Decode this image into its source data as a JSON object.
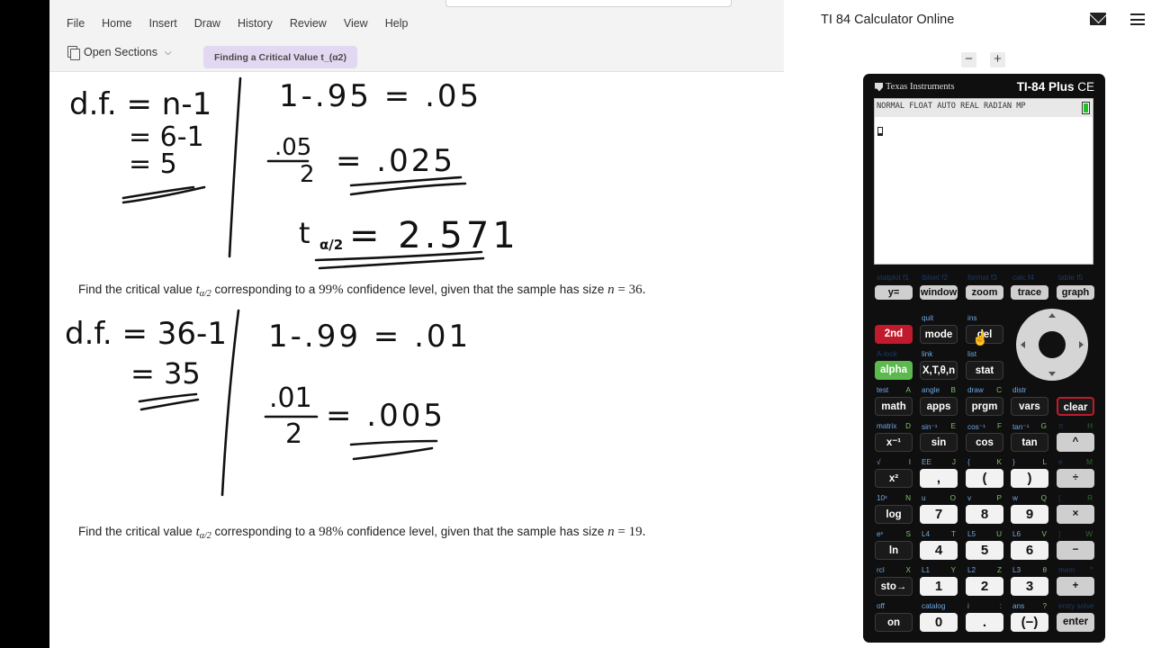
{
  "onenote": {
    "menu": [
      "File",
      "Home",
      "Insert",
      "Draw",
      "History",
      "Review",
      "View",
      "Help"
    ],
    "open_sections_label": "Open Sections",
    "page_tab_label": "Finding a Critical Value t_(α2)",
    "problem2": {
      "prefix": "Find the critical value",
      "t_symbol": "t",
      "subscript": "α/2",
      "mid": "corresponding to a",
      "percent": "99%",
      "rest": "confidence level, given that the sample has size",
      "n_var": "n",
      "equals": "=",
      "n_value": "36."
    },
    "problem3": {
      "prefix": "Find the critical value",
      "t_symbol": "t",
      "subscript": "α/2",
      "mid": "corresponding to a",
      "percent": "98%",
      "rest": "confidence level, given that the sample has size",
      "n_var": "n",
      "equals": "=",
      "n_value": "19."
    },
    "handwriting": {
      "p1": {
        "df_line1": "d.f. = n-1",
        "df_line2": "= 6-1",
        "df_line3": "= 5",
        "calc_line1": "1-.95 = .05",
        "frac_num": ".05",
        "frac_den": "2",
        "frac_eq": "= .025",
        "t_result": "= 2.571",
        "t_label": "t",
        "t_sub": "α/2"
      },
      "p2": {
        "df_line1": "d.f. = 36-1",
        "df_line2": "= 35",
        "calc_line1": "1-.99 = .01",
        "frac_num": ".01",
        "frac_den": "2",
        "frac_eq": "= .005"
      }
    }
  },
  "calculator_app": {
    "title": "TI 84 Calculator Online",
    "mail_icon": "mail-icon",
    "menu_icon": "hamburger-menu-icon",
    "zoom_out": "−",
    "zoom_in": "+",
    "brand": "Texas Instruments",
    "model": "TI-84 Plus",
    "model_suffix": "CE",
    "status_bar": "NORMAL FLOAT AUTO REAL RADIAN MP",
    "func_keys": [
      {
        "sec": "statplot f1",
        "label": "y="
      },
      {
        "sec": "tblset f2",
        "label": "window"
      },
      {
        "sec": "format f3",
        "label": "zoom"
      },
      {
        "sec": "calc  f4",
        "label": "trace"
      },
      {
        "sec": "table  f5",
        "label": "graph"
      }
    ],
    "keys": [
      {
        "sec": "",
        "alpha": "",
        "label": "2nd"
      },
      {
        "sec": "quit",
        "alpha": "",
        "label": "mode"
      },
      {
        "sec": "ins",
        "alpha": "",
        "label": "del"
      },
      {
        "sec": "A-lock",
        "alpha": "",
        "label": "alpha"
      },
      {
        "sec": "link",
        "alpha": "",
        "label": "X,T,θ,n"
      },
      {
        "sec": "list",
        "alpha": "",
        "label": "stat"
      },
      {
        "sec": "test",
        "alpha": "A",
        "label": "math"
      },
      {
        "sec": "angle",
        "alpha": "B",
        "label": "apps"
      },
      {
        "sec": "draw",
        "alpha": "C",
        "label": "prgm"
      },
      {
        "sec": "distr",
        "alpha": "",
        "label": "vars"
      },
      {
        "sec": "",
        "alpha": "",
        "label": "clear"
      },
      {
        "sec": "matrix",
        "alpha": "D",
        "label": "x⁻¹"
      },
      {
        "sec": "sin⁻¹",
        "alpha": "E",
        "label": "sin"
      },
      {
        "sec": "cos⁻¹",
        "alpha": "F",
        "label": "cos"
      },
      {
        "sec": "tan⁻¹",
        "alpha": "G",
        "label": "tan"
      },
      {
        "sec": "π",
        "alpha": "H",
        "label": "^"
      },
      {
        "sec": "√",
        "alpha": "I",
        "label": "x²"
      },
      {
        "sec": "EE",
        "alpha": "J",
        "label": ","
      },
      {
        "sec": "{",
        "alpha": "K",
        "label": "("
      },
      {
        "sec": "}",
        "alpha": "L",
        "label": ")"
      },
      {
        "sec": "e",
        "alpha": "M",
        "label": "÷"
      },
      {
        "sec": "10ˣ",
        "alpha": "N",
        "label": "log"
      },
      {
        "sec": "u",
        "alpha": "O",
        "label": "7"
      },
      {
        "sec": "v",
        "alpha": "P",
        "label": "8"
      },
      {
        "sec": "w",
        "alpha": "Q",
        "label": "9"
      },
      {
        "sec": "[",
        "alpha": "R",
        "label": "×"
      },
      {
        "sec": "eˣ",
        "alpha": "S",
        "label": "ln"
      },
      {
        "sec": "L4",
        "alpha": "T",
        "label": "4"
      },
      {
        "sec": "L5",
        "alpha": "U",
        "label": "5"
      },
      {
        "sec": "L6",
        "alpha": "V",
        "label": "6"
      },
      {
        "sec": "]",
        "alpha": "W",
        "label": "−"
      },
      {
        "sec": "rcl",
        "alpha": "X",
        "label": "sto→"
      },
      {
        "sec": "L1",
        "alpha": "Y",
        "label": "1"
      },
      {
        "sec": "L2",
        "alpha": "Z",
        "label": "2"
      },
      {
        "sec": "L3",
        "alpha": "θ",
        "label": "3"
      },
      {
        "sec": "mem",
        "alpha": "“",
        "label": "+"
      },
      {
        "sec": "off",
        "alpha": "",
        "label": "on"
      },
      {
        "sec": "catalog",
        "alpha": "",
        "label": "0"
      },
      {
        "sec": "i",
        "alpha": ":",
        "label": "."
      },
      {
        "sec": "ans",
        "alpha": "?",
        "label": "(−)"
      },
      {
        "sec": "entry solve",
        "alpha": "",
        "label": "enter"
      }
    ]
  }
}
